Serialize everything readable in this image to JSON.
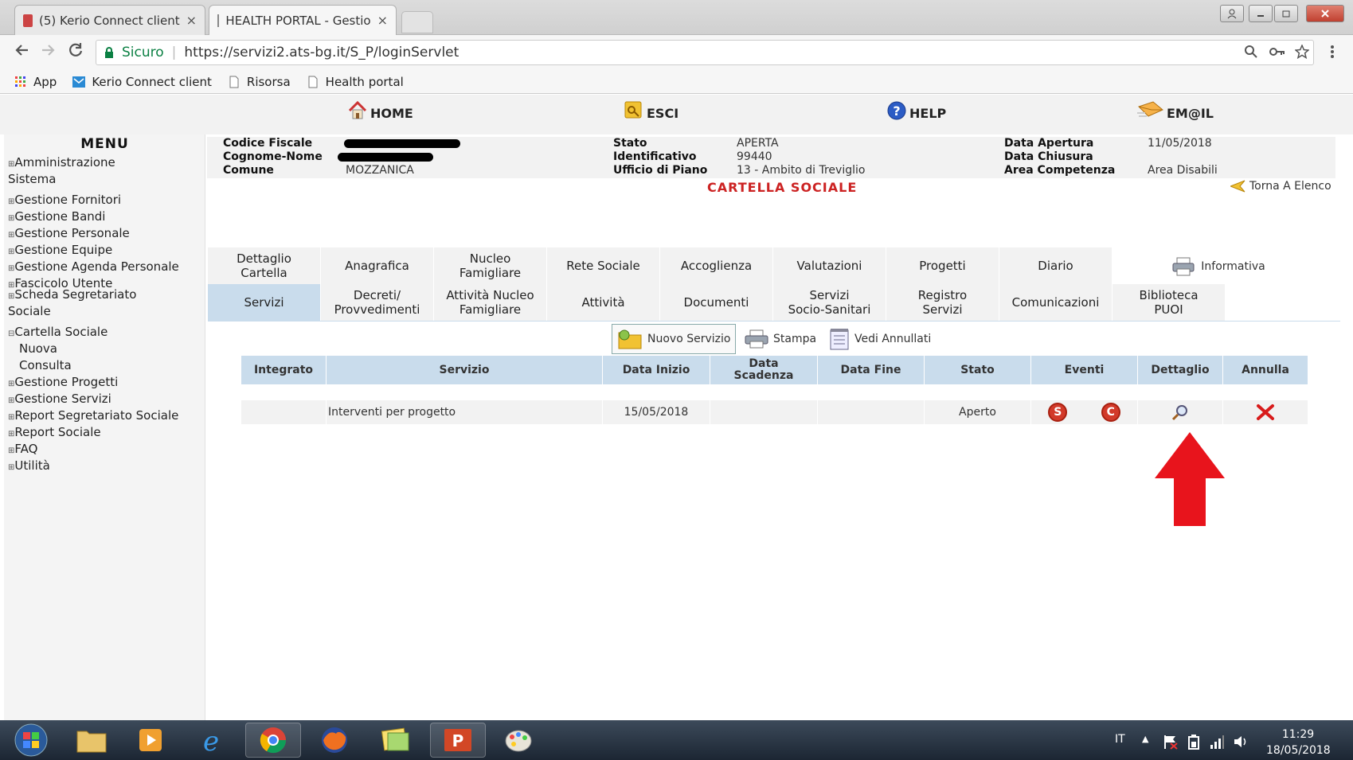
{
  "browser": {
    "tabs": [
      {
        "label": "(5) Kerio Connect client",
        "close": "×"
      },
      {
        "label": "HEALTH PORTAL - Gestio",
        "close": "×"
      }
    ],
    "secure_label": "Sicuro",
    "url": "https://servizi2.ats-bg.it/S_P/loginServlet",
    "bookmarks": [
      "App",
      "Kerio Connect client",
      "Risorsa",
      "Health portal"
    ]
  },
  "topnav": {
    "home": "HOME",
    "esci": "ESCI",
    "help": "HELP",
    "email": "EM@IL"
  },
  "menu": {
    "title": "MENU",
    "items": [
      {
        "pm": "⊞",
        "label": "Amministrazione",
        "label2": "Sistema"
      },
      {
        "pm": "⊞",
        "label": "Gestione Fornitori"
      },
      {
        "pm": "⊞",
        "label": "Gestione Bandi"
      },
      {
        "pm": "⊞",
        "label": "Gestione Personale"
      },
      {
        "pm": "⊞",
        "label": "Gestione Equipe"
      },
      {
        "pm": "⊞",
        "label": "Gestione Agenda Personale"
      },
      {
        "pm": "⊞",
        "label": "Fascicolo Utente"
      },
      {
        "pm": "⊞",
        "label": "Scheda Segretariato",
        "label2": "Sociale"
      },
      {
        "pm": "⊟",
        "label": "Cartella Sociale"
      },
      {
        "pm": "",
        "label": "Nuova"
      },
      {
        "pm": "",
        "label": "Consulta"
      },
      {
        "pm": "⊞",
        "label": "Gestione Progetti"
      },
      {
        "pm": "⊞",
        "label": "Gestione Servizi"
      },
      {
        "pm": "⊞",
        "label": "Report Segretariato Sociale"
      },
      {
        "pm": "⊞",
        "label": "Report Sociale"
      },
      {
        "pm": "⊞",
        "label": "FAQ"
      },
      {
        "pm": "⊞",
        "label": "Utilità"
      }
    ]
  },
  "header": {
    "codice_fiscale_label": "Codice Fiscale",
    "cognome_nome_label": "Cognome-Nome",
    "comune_label": "Comune",
    "comune_value": "MOZZANICA",
    "stato_label": "Stato",
    "stato_value": "APERTA",
    "identificativo_label": "Identificativo",
    "identificativo_value": "99440",
    "ufficio_label": "Ufficio di Piano",
    "ufficio_value": "13 - Ambito di Treviglio",
    "data_apertura_label": "Data Apertura",
    "data_apertura_value": "11/05/2018",
    "data_chiusura_label": "Data Chiusura",
    "area_label": "Area Competenza",
    "area_value": "Area Disabili",
    "title": "CARTELLA SOCIALE",
    "torna": "Torna A Elenco"
  },
  "tabs_row1": [
    {
      "l1": "Dettaglio",
      "l2": "Cartella"
    },
    {
      "l1": "Anagrafica",
      "l2": ""
    },
    {
      "l1": "Nucleo",
      "l2": "Famigliare"
    },
    {
      "l1": "Rete Sociale",
      "l2": ""
    },
    {
      "l1": "Accoglienza",
      "l2": ""
    },
    {
      "l1": "Valutazioni",
      "l2": ""
    },
    {
      "l1": "Progetti",
      "l2": ""
    },
    {
      "l1": "Diario",
      "l2": ""
    }
  ],
  "informativa": "Informativa",
  "tabs_row2": [
    {
      "l1": "Servizi",
      "l2": ""
    },
    {
      "l1": "Decreti/",
      "l2": "Provvedimenti"
    },
    {
      "l1": "Attività Nucleo",
      "l2": "Famigliare"
    },
    {
      "l1": "Attività",
      "l2": ""
    },
    {
      "l1": "Documenti",
      "l2": ""
    },
    {
      "l1": "Servizi",
      "l2": "Socio-Sanitari"
    },
    {
      "l1": "Registro",
      "l2": "Servizi"
    },
    {
      "l1": "Comunicazioni",
      "l2": ""
    },
    {
      "l1": "Biblioteca",
      "l2": "PUOI"
    }
  ],
  "toolbar": {
    "nuovo": "Nuovo Servizio",
    "stampa": "Stampa",
    "annullati": "Vedi Annullati"
  },
  "table": {
    "headers": [
      {
        "l1": "Integrato",
        "l2": ""
      },
      {
        "l1": "Servizio",
        "l2": ""
      },
      {
        "l1": "Data Inizio",
        "l2": ""
      },
      {
        "l1": "Data",
        "l2": "Scadenza"
      },
      {
        "l1": "Data Fine",
        "l2": ""
      },
      {
        "l1": "Stato",
        "l2": ""
      },
      {
        "l1": "Eventi",
        "l2": ""
      },
      {
        "l1": "Dettaglio",
        "l2": ""
      },
      {
        "l1": "Annulla",
        "l2": ""
      }
    ],
    "rows": [
      {
        "integrato": "",
        "servizio": "Interventi per progetto",
        "data_inizio": "15/05/2018",
        "data_scadenza": "",
        "data_fine": "",
        "stato": "Aperto",
        "evento_s": "S",
        "evento_c": "C"
      }
    ]
  },
  "taskbar": {
    "lang": "IT",
    "time": "11:29",
    "date": "18/05/2018"
  },
  "colors": {
    "tab_selected": "#c9dcec",
    "title_red": "#cc2222",
    "arrow_red": "#e8141c"
  }
}
